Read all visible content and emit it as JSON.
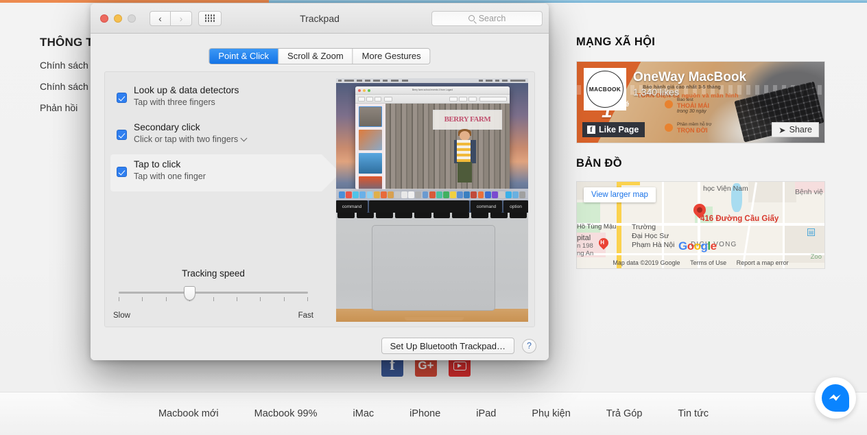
{
  "page": {
    "left_column": {
      "title": "THÔNG T",
      "links": [
        "Chính sách",
        "Chính sách",
        "Phản hồi"
      ]
    },
    "right_column": {
      "social_title": "MẠNG XÃ HỘI",
      "map_title": "BẢN ĐỒ",
      "facebook_widget": {
        "page_name": "OneWay MacBook",
        "likes": "1,340 likes",
        "avatar_text": "MACBOOK",
        "like_button": "Like Page",
        "share_button": "Share",
        "banner_line1": "Bảo hành giá cao nhất 3-5 tháng",
        "banner_line2": "TOÀN DIỆN cả nguồn và màn hình",
        "badge_big": "1",
        "badge_small": "vé",
        "promo1_small": "Bao test",
        "promo1_big": "THOẢI MÁI",
        "promo1_sub": "trong 30 ngày",
        "promo2_small": "Phần mềm hỗ trợ",
        "promo2_big": "TRỌN ĐỜI"
      },
      "map_widget": {
        "view_larger": "View larger map",
        "address": "416 Đường Cầu Giấy",
        "labels": [
          "học Viện Nam",
          "Bệnh việ",
          "Hồ Tùng Mậu",
          "Trường",
          "Đại Học Sư",
          "Phạm Hà Nội",
          "DICH VONG",
          "pital",
          "n 198",
          "ng An",
          "Zoo"
        ],
        "logo": "Google",
        "attribution": [
          "Map data ©2019 Google",
          "Terms of Use",
          "Report a map error"
        ]
      }
    },
    "social_icons": [
      {
        "name": "facebook-icon",
        "glyph": "f",
        "color": "#3b5998"
      },
      {
        "name": "google-plus-icon",
        "glyph": "G+",
        "color": "#d34836"
      },
      {
        "name": "youtube-icon",
        "glyph": "▶",
        "color": "#e02f2f"
      }
    ],
    "bottom_nav": [
      "Macbook mới",
      "Macbook 99%",
      "iMac",
      "iPhone",
      "iPad",
      "Phụ kiện",
      "Trả Góp",
      "Tin tức"
    ],
    "messenger_bubble": "messenger-icon",
    "progress_bar": {
      "color": "#ec8a4f",
      "percent": 31
    }
  },
  "prefs_window": {
    "title": "Trackpad",
    "search_placeholder": "Search",
    "traffic_lights": [
      "close",
      "minimize",
      "zoom"
    ],
    "nav_back": "‹",
    "nav_forward": "›",
    "grid_button": "show-all-icon",
    "tabs": [
      {
        "label": "Point & Click",
        "active": true
      },
      {
        "label": "Scroll & Zoom",
        "active": false
      },
      {
        "label": "More Gestures",
        "active": false
      }
    ],
    "options": [
      {
        "title": "Look up & data detectors",
        "subtitle": "Tap with three fingers",
        "checked": true,
        "selected": false,
        "has_dropdown": false
      },
      {
        "title": "Secondary click",
        "subtitle": "Click or tap with two fingers",
        "checked": true,
        "selected": false,
        "has_dropdown": true
      },
      {
        "title": "Tap to click",
        "subtitle": "Tap with one finger",
        "checked": true,
        "selected": true,
        "has_dropdown": false
      }
    ],
    "tracking": {
      "label": "Tracking speed",
      "min_label": "Slow",
      "max_label": "Fast",
      "tick_count": 9,
      "value_index": 3
    },
    "preview": {
      "banner_text": "BERRY FARM",
      "key_left": "command",
      "key_right1": "command",
      "key_right2": "option"
    },
    "footer": {
      "setup_button": "Set Up Bluetooth Trackpad…",
      "help_button": "?"
    }
  }
}
